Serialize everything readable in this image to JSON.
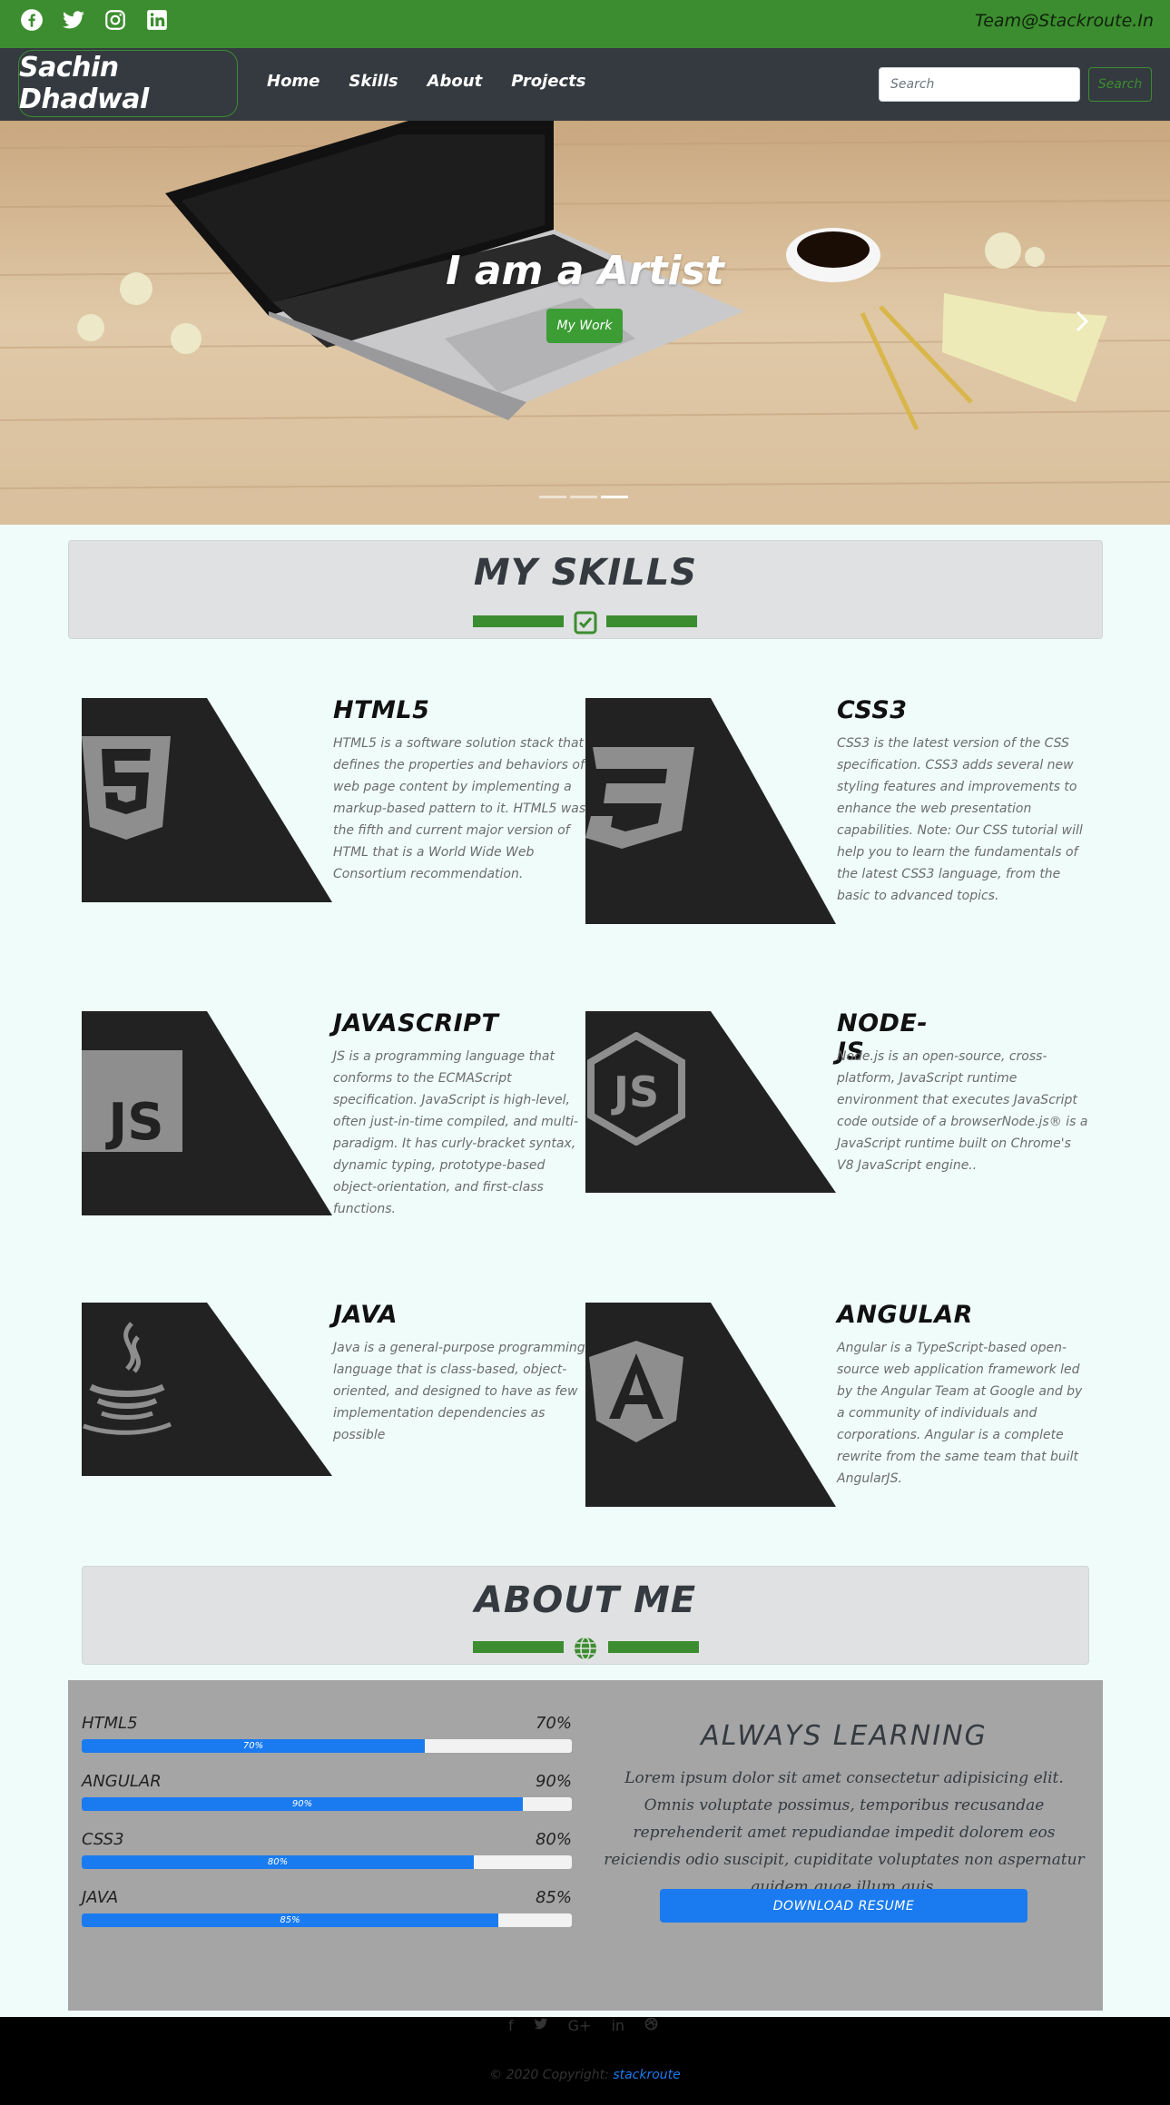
{
  "topbar": {
    "social_icons": [
      "facebook-icon",
      "twitter-icon",
      "instagram-icon",
      "linkedin-icon"
    ],
    "email": "Team@Stackroute.In"
  },
  "navbar": {
    "brand": "Sachin Dhadwal",
    "links": [
      "Home",
      "Skills",
      "About",
      "Projects"
    ],
    "search_placeholder": "Search",
    "search_button": "Search"
  },
  "hero": {
    "title": "I am a Artist",
    "button": "My Work",
    "next_icon": "chevron-right-icon",
    "slide_count": 3,
    "active_slide": 3
  },
  "skills_section": {
    "title": "MY SKILLS",
    "icon": "check-square-icon",
    "items": [
      {
        "name": "HTML5",
        "icon": "html5-icon",
        "text": "HTML5 is a software solution stack that defines the properties and behaviors of web page content by implementing a markup-based pattern to it. HTML5 was the fifth and current major version of HTML that is a World Wide Web Consortium recommendation."
      },
      {
        "name": "CSS3",
        "icon": "css3-icon",
        "text": "CSS3 is the latest version of the CSS specification. CSS3 adds several new styling features and improvements to enhance the web presentation capabilities. Note: Our CSS tutorial will help you to learn the fundamentals of the latest CSS3 language, from the basic to advanced topics."
      },
      {
        "name": "JAVASCRIPT",
        "icon": "javascript-icon",
        "text": "JS is a programming language that conforms to the ECMAScript specification. JavaScript is high-level, often just-in-time compiled, and multi-paradigm. It has curly-bracket syntax, dynamic typing, prototype-based object-orientation, and first-class functions."
      },
      {
        "name": "NODE-JS",
        "icon": "nodejs-icon",
        "text": "Node.js is an open-source, cross-platform, JavaScript runtime environment that executes JavaScript code outside of a browserNode.js® is a JavaScript runtime built on Chrome's V8 JavaScript engine.."
      },
      {
        "name": "JAVA",
        "icon": "java-icon",
        "text": "Java is a general-purpose programming language that is class-based, object-oriented, and designed to have as few implementation dependencies as possible"
      },
      {
        "name": "ANGULAR",
        "icon": "angular-icon",
        "text": "Angular is a TypeScript-based open-source web application framework led by the Angular Team at Google and by a community of individuals and corporations. Angular is a complete rewrite from the same team that built AngularJS."
      }
    ]
  },
  "about_section": {
    "title": "ABOUT ME",
    "icon": "globe-icon",
    "progress": [
      {
        "label": "HTML5",
        "percent_text": "70%",
        "bar_text": "70%",
        "value": 70
      },
      {
        "label": "ANGULAR",
        "percent_text": "90%",
        "bar_text": "90%",
        "value": 90
      },
      {
        "label": "CSS3",
        "percent_text": "80%",
        "bar_text": "80%",
        "value": 80
      },
      {
        "label": "JAVA",
        "percent_text": "85%",
        "bar_text": "85%",
        "value": 85
      }
    ],
    "heading": "ALWAYS LEARNING",
    "text": "Lorem ipsum dolor sit amet consectetur adipisicing elit. Omnis voluptate possimus, temporibus recusandae reprehenderit amet repudiandae impedit dolorem eos reiciendis odio suscipit, cupiditate voluptates non aspernatur quidem quae illum quis.",
    "button": "DOWNLOAD RESUME"
  },
  "footer": {
    "icons": [
      "facebook-icon",
      "twitter-icon",
      "google-plus-icon",
      "linkedin-icon",
      "dribbble-icon"
    ],
    "copyright": "© 2020 Copyright:",
    "link": "stackroute"
  },
  "colors": {
    "brand_green": "#3c8d2f",
    "navbar_dark": "#343a40",
    "progress_blue": "#1a7bf0",
    "page_background": "#effcf9",
    "tile_dark": "#222222",
    "tile_icon": "#8e8e8e"
  }
}
